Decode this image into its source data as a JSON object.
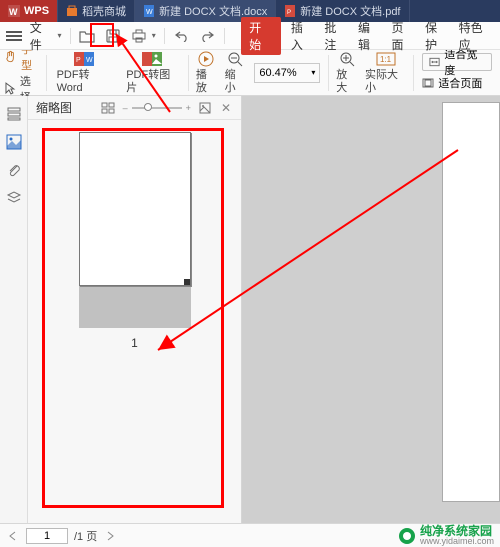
{
  "header": {
    "app_tabs": [
      {
        "label": "WPS"
      },
      {
        "label": "稻壳商城"
      },
      {
        "label": "新建 DOCX 文档.docx"
      },
      {
        "label": "新建 DOCX 文档.pdf"
      }
    ]
  },
  "quick_access": {
    "file_label": "文件",
    "menu_tabs": {
      "active": "开始",
      "items": [
        "开始",
        "插入",
        "批注",
        "编辑",
        "页面",
        "保护",
        "特色应"
      ]
    }
  },
  "ribbon": {
    "hand_tool": "手型",
    "select": "选择",
    "pdf_to_word": "PDF转Word",
    "pdf_to_img": "PDF转图片",
    "play": "播放",
    "zoom_out": "缩小",
    "zoom_value": "60.47%",
    "zoom_in": "放大",
    "actual_size": "实际大小",
    "one_to_one": "1:1",
    "fit_width": "适合宽度",
    "fit_page": "适合页面"
  },
  "thumbnail_panel": {
    "title": "缩略图",
    "page_number": "1"
  },
  "status_bar": {
    "current_page": "1",
    "page_sep": "/1 页"
  },
  "watermark": {
    "brand": "纯净系统家园",
    "url": "www.yidaimei.com"
  },
  "colors": {
    "accent_red": "#d63a2f",
    "annotation_red": "#ff0000",
    "header_bg": "#2a3b5f",
    "wps_red": "#b2302b"
  }
}
